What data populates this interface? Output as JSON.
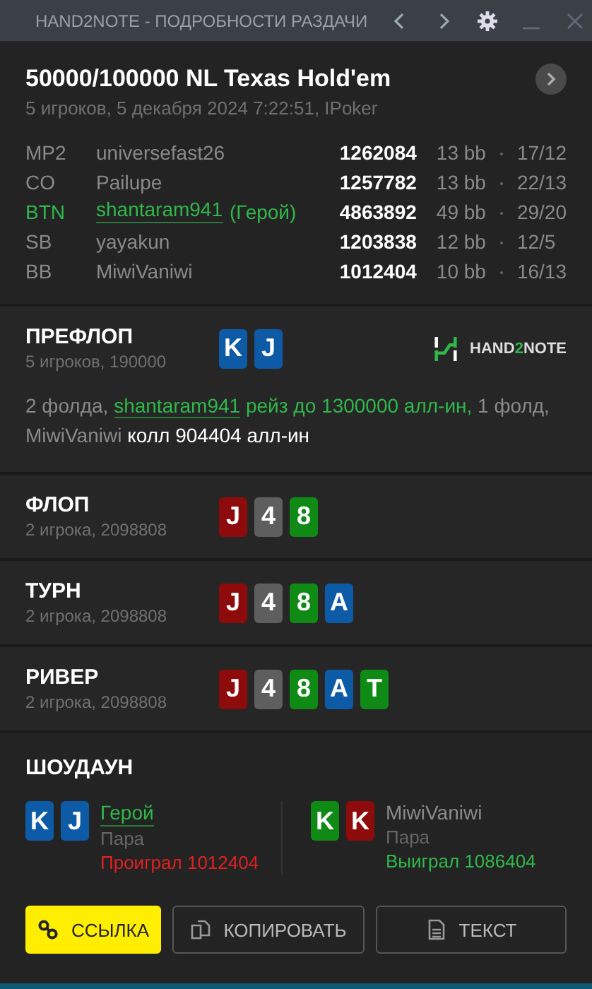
{
  "window": {
    "title": "HAND2NOTE - ПОДРОБНОСТИ РАЗДАЧИ"
  },
  "header": {
    "title": "50000/100000 NL Texas Hold'em",
    "subtitle": "5 игроков, 5 декабря 2024 7:22:51, IPoker"
  },
  "players": [
    {
      "position": "MP2",
      "name": "universefast26",
      "is_hero": false,
      "stack": "1262084",
      "bb": "13 bb",
      "ratio": "17/12"
    },
    {
      "position": "CO",
      "name": "Pailupe",
      "is_hero": false,
      "stack": "1257782",
      "bb": "13 bb",
      "ratio": "22/13"
    },
    {
      "position": "BTN",
      "name": "shantaram941",
      "is_hero": true,
      "hero_label": "(Герой)",
      "stack": "4863892",
      "bb": "49 bb",
      "ratio": "29/20"
    },
    {
      "position": "SB",
      "name": "yayakun",
      "is_hero": false,
      "stack": "1203838",
      "bb": "12 bb",
      "ratio": "12/5"
    },
    {
      "position": "BB",
      "name": "MiwiVaniwi",
      "is_hero": false,
      "stack": "1012404",
      "bb": "10 bb",
      "ratio": "16/13"
    }
  ],
  "streets": [
    {
      "name": "ПРЕФЛОП",
      "info": "5 игроков, 190000",
      "logo": {
        "before": "HAND",
        "accent": "2",
        "after": "NOTE"
      },
      "cards": [
        {
          "rank": "K",
          "color": "#0d5aa7"
        },
        {
          "rank": "J",
          "color": "#0d5aa7"
        }
      ],
      "action": [
        {
          "kind": "plain",
          "text": "2 фолда,"
        },
        {
          "kind": "link",
          "text": "shantaram941"
        },
        {
          "kind": "hero",
          "text": "рейз до 1300000 алл-ин,"
        },
        {
          "kind": "plain",
          "text": "1 фолд, MiwiVaniwi"
        },
        {
          "kind": "strong",
          "text": "колл 904404 алл-ин"
        }
      ]
    },
    {
      "name": "ФЛОП",
      "info": "2 игрока, 2098808",
      "cards": [
        {
          "rank": "J",
          "color": "#8e0b0b"
        },
        {
          "rank": "4",
          "color": "#5e5e5e"
        },
        {
          "rank": "8",
          "color": "#0f8a14"
        }
      ]
    },
    {
      "name": "ТУРН",
      "info": "2 игрока, 2098808",
      "cards": [
        {
          "rank": "J",
          "color": "#8e0b0b"
        },
        {
          "rank": "4",
          "color": "#5e5e5e"
        },
        {
          "rank": "8",
          "color": "#0f8a14"
        },
        {
          "rank": "A",
          "color": "#0d5aa7"
        }
      ]
    },
    {
      "name": "РИВЕР",
      "info": "2 игрока, 2098808",
      "cards": [
        {
          "rank": "J",
          "color": "#8e0b0b"
        },
        {
          "rank": "4",
          "color": "#5e5e5e"
        },
        {
          "rank": "8",
          "color": "#0f8a14"
        },
        {
          "rank": "A",
          "color": "#0d5aa7"
        },
        {
          "rank": "T",
          "color": "#0f8a14"
        }
      ]
    }
  ],
  "showdown": {
    "title": "ШОУДАУН",
    "hands": [
      {
        "name": "Герой",
        "is_hero": true,
        "hand": "Пара",
        "result": "Проиграл 1012404",
        "won": false,
        "cards": [
          {
            "rank": "K",
            "color": "#0d5aa7"
          },
          {
            "rank": "J",
            "color": "#0d5aa7"
          }
        ]
      },
      {
        "name": "MiwiVaniwi",
        "is_hero": false,
        "hand": "Пара",
        "result": "Выиграл 1086404",
        "won": true,
        "cards": [
          {
            "rank": "K",
            "color": "#0f8a14"
          },
          {
            "rank": "K",
            "color": "#8e0b0b"
          }
        ]
      }
    ]
  },
  "buttons": [
    {
      "kind": "link",
      "label": "ССЫЛКА",
      "primary": true
    },
    {
      "kind": "copy",
      "label": "КОПИРОВАТЬ",
      "primary": false
    },
    {
      "kind": "text",
      "label": "ТЕКСТ",
      "primary": false
    }
  ]
}
